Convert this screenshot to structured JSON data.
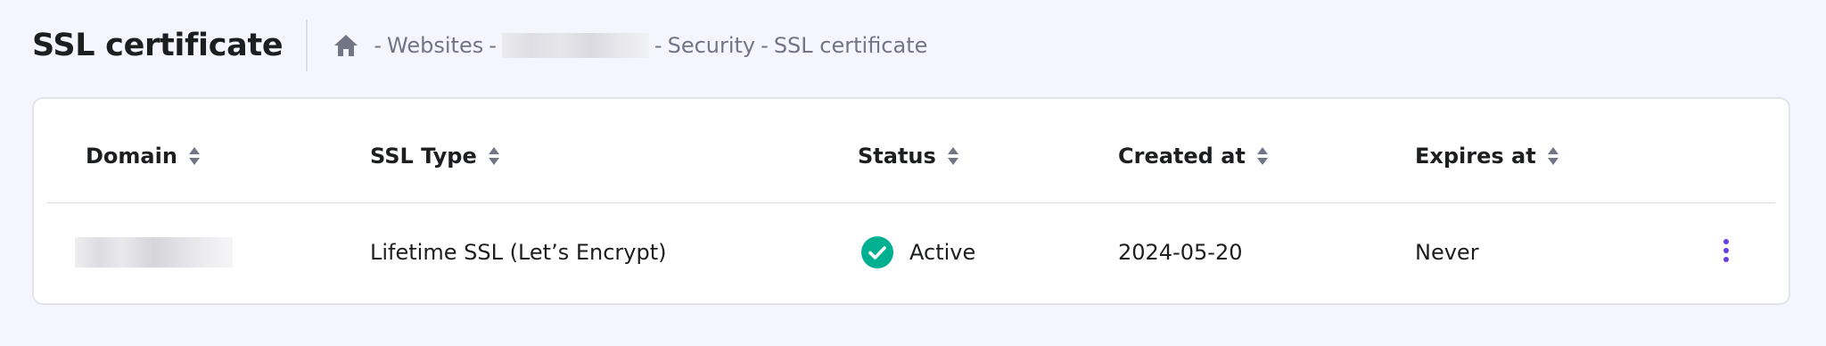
{
  "page": {
    "title": "SSL certificate"
  },
  "breadcrumb": {
    "home_icon": "home-icon",
    "separator": "-",
    "items": [
      "Websites",
      "Security",
      "SSL certificate"
    ]
  },
  "table": {
    "columns": [
      {
        "label": "Domain",
        "sortable": true
      },
      {
        "label": "SSL Type",
        "sortable": true
      },
      {
        "label": "Status",
        "sortable": true
      },
      {
        "label": "Created at",
        "sortable": true
      },
      {
        "label": "Expires at",
        "sortable": true
      }
    ],
    "rows": [
      {
        "ssl_type": "Lifetime SSL (Let’s Encrypt)",
        "status": "Active",
        "status_icon": "check-circle-icon",
        "created_at": "2024-05-20",
        "expires_at": "Never",
        "actions_icon": "more-vertical-icon"
      }
    ]
  },
  "colors": {
    "background": "#f4f5ff",
    "status_active": "#00b090",
    "accent": "#673de6",
    "muted_text": "#727586"
  }
}
